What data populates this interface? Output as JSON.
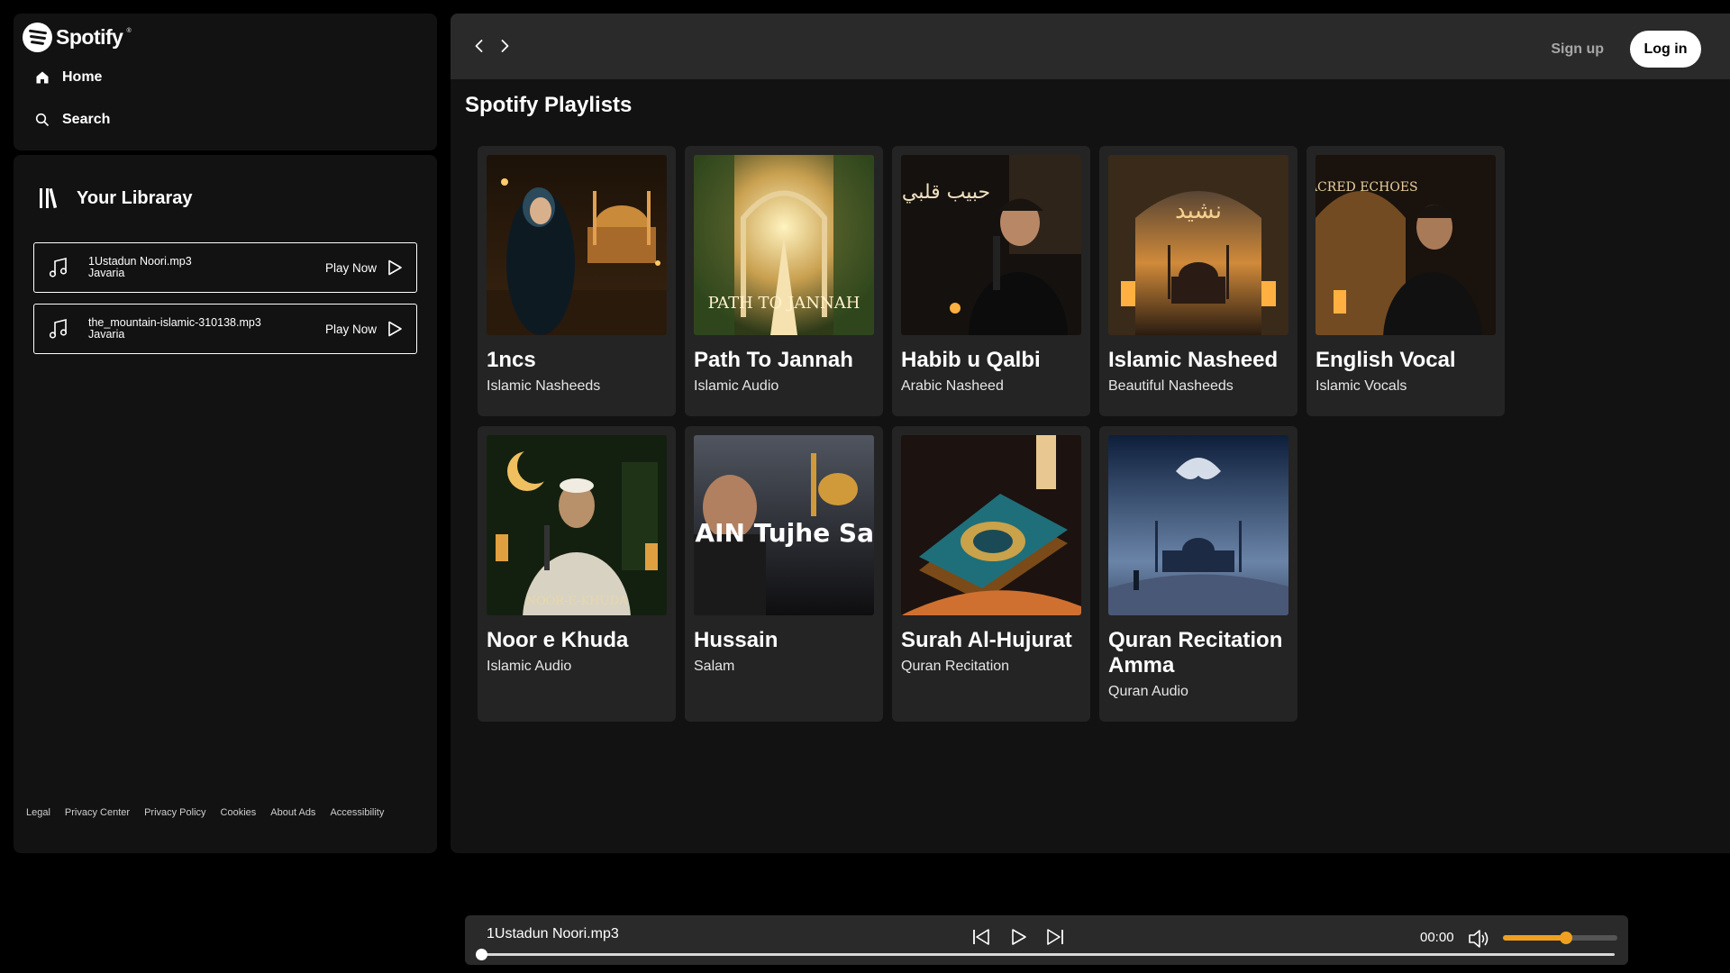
{
  "app": {
    "brand": "Spotify",
    "trademark": "®"
  },
  "nav": {
    "home": "Home",
    "search": "Search"
  },
  "library": {
    "title": "Your Libraray",
    "tracks": [
      {
        "name": "1Ustadun Noori.mp3",
        "artist": "Javaria",
        "action": "Play Now"
      },
      {
        "name": "the_mountain-islamic-310138.mp3",
        "artist": "Javaria",
        "action": "Play Now"
      }
    ]
  },
  "footer": {
    "links": [
      "Legal",
      "Privacy Center",
      "Privacy Policy",
      "Cookies",
      "About Ads",
      "Accessibility"
    ]
  },
  "header": {
    "signup": "Sign up",
    "login": "Log in"
  },
  "main": {
    "section_title": "Spotify Playlists",
    "playlists": [
      {
        "title": "1ncs",
        "subtitle": "Islamic Nasheeds",
        "cover_text": ""
      },
      {
        "title": "Path To Jannah",
        "subtitle": "Islamic Audio",
        "cover_text": "PATH TO JANNAH"
      },
      {
        "title": "Habib u Qalbi",
        "subtitle": "Arabic Nasheed",
        "cover_text": "حبيب قلبي"
      },
      {
        "title": "Islamic Nasheed",
        "subtitle": "Beautiful Nasheeds",
        "cover_text": "نشيد"
      },
      {
        "title": "English Vocal",
        "subtitle": "Islamic Vocals",
        "cover_text": "SACRED ECHOES"
      },
      {
        "title": "Noor e Khuda",
        "subtitle": "Islamic Audio",
        "cover_text": "NOOR-E-KHUDA"
      },
      {
        "title": "Hussain",
        "subtitle": "Salam",
        "cover_text": "MERE HUSSAIN Tujhe Sa"
      },
      {
        "title": "Surah Al-Hujurat",
        "subtitle": "Quran Recitation",
        "cover_text": ""
      },
      {
        "title": "Quran Recitation Amma",
        "subtitle": "Quran Audio",
        "cover_text": ""
      }
    ]
  },
  "player": {
    "track": "1Ustadun Noori.mp3",
    "time": "00:00",
    "progress": 0,
    "volume": 0.55
  },
  "colors": {
    "accent": "#f0a020",
    "panel": "#121212",
    "topbar": "#2a2a2a",
    "card": "#242424"
  }
}
